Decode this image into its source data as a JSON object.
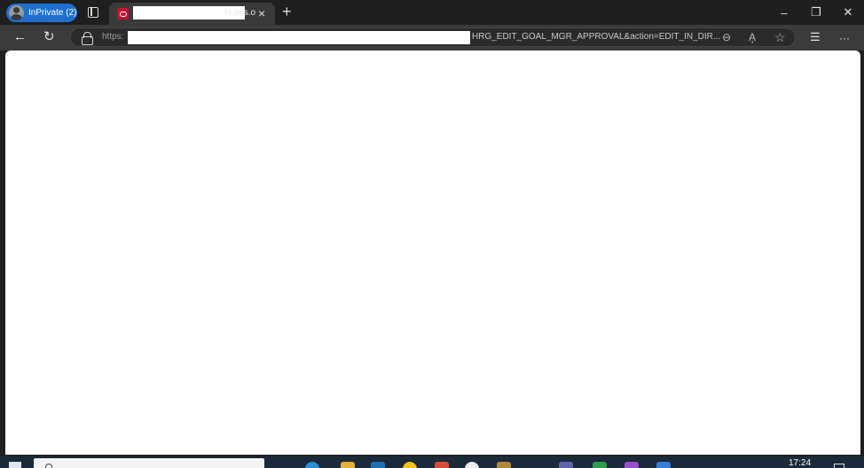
{
  "browser": {
    "profile_label": "InPrivate (2)",
    "tab": {
      "title_visible": "fa.ocs.o",
      "close_glyph": "×"
    },
    "new_tab_glyph": "+",
    "window_controls": {
      "minimize": "–",
      "restore": "❐",
      "close": "✕"
    }
  },
  "toolbar": {
    "back_glyph": "←",
    "refresh_glyph": "↻",
    "url_scheme": "https:",
    "url_tail": "HRG_EDIT_GOAL_MGR_APPROVAL&action=EDIT_IN_DIR...",
    "zoom_glyph": "⊖",
    "read_aloud_glyph": "A̧",
    "favorite_glyph": "☆",
    "favorites_glyph": "☰",
    "more_glyph": "···"
  },
  "taskbar": {
    "clock": "17:24"
  },
  "colors": {
    "inprivate_accent": "#1e6fd0",
    "oracle_red": "#c8102e",
    "page_bg": "#ffffff"
  }
}
